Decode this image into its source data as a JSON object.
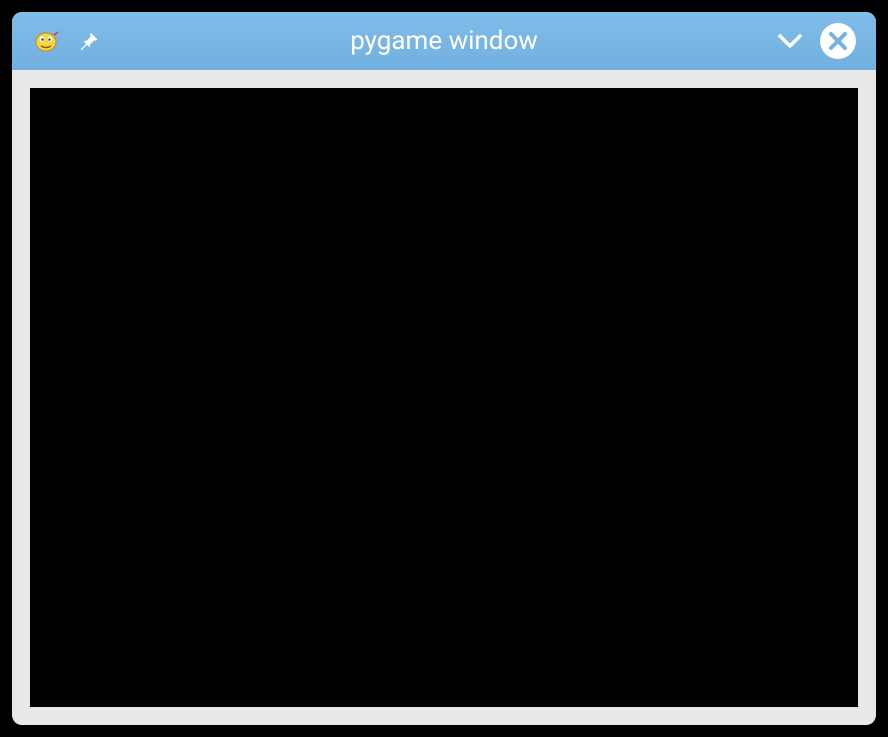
{
  "window": {
    "title": "pygame window"
  },
  "colors": {
    "titlebar": "#76b2e2",
    "canvas": "#000000",
    "frame": "#e8e8e8"
  }
}
